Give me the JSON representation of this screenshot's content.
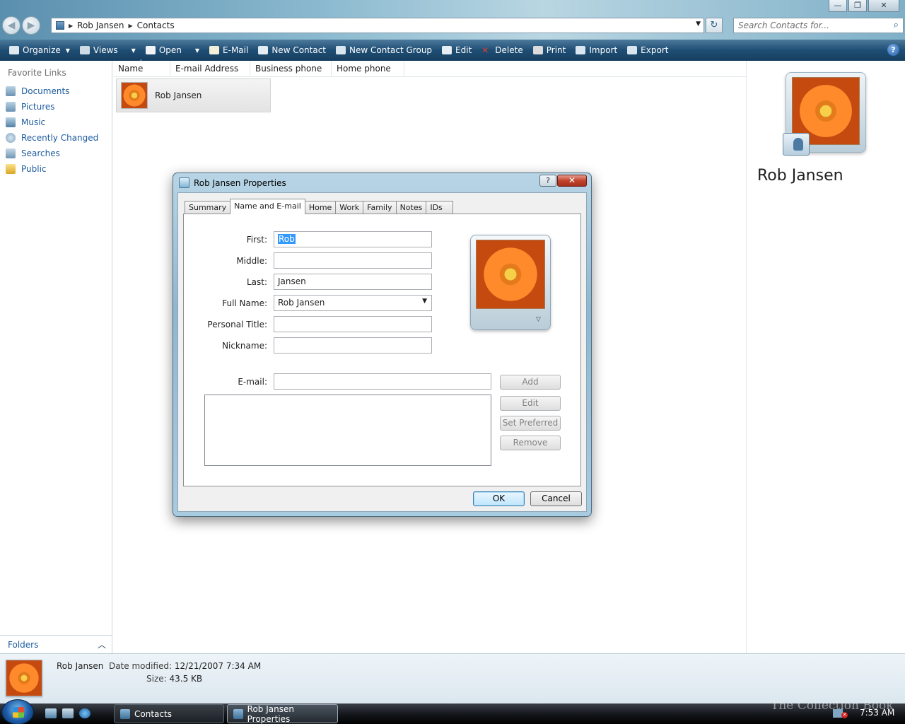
{
  "window": {
    "breadcrumb": [
      "Rob Jansen",
      "Contacts"
    ],
    "search_placeholder": "Search Contacts for...",
    "buttons": {
      "minimize": "—",
      "maximize": "❐",
      "close": "✕"
    }
  },
  "toolbar": {
    "items": [
      "Organize",
      "Views",
      "Open",
      "E-Mail",
      "New Contact",
      "New Contact Group",
      "Edit",
      "Delete",
      "Print",
      "Import",
      "Export"
    ]
  },
  "leftnav": {
    "heading": "Favorite Links",
    "items": [
      "Documents",
      "Pictures",
      "Music",
      "Recently Changed",
      "Searches",
      "Public"
    ],
    "folders": "Folders"
  },
  "list": {
    "columns": [
      "Name",
      "E-mail Address",
      "Business phone",
      "Home phone"
    ],
    "contacts": [
      {
        "name": "Rob Jansen"
      }
    ]
  },
  "preview": {
    "name": "Rob Jansen"
  },
  "details": {
    "name": "Rob Jansen",
    "modified_label": "Date modified:",
    "modified_value": "12/21/2007 7:34 AM",
    "size_label": "Size:",
    "size_value": "43.5 KB"
  },
  "dialog": {
    "title": "Rob Jansen Properties",
    "help": "?",
    "close": "✕",
    "tabs": [
      "Summary",
      "Name and E-mail",
      "Home",
      "Work",
      "Family",
      "Notes",
      "IDs"
    ],
    "active_tab": "Name and E-mail",
    "fields": {
      "first_label": "First:",
      "first_value": "Rob",
      "middle_label": "Middle:",
      "middle_value": "",
      "last_label": "Last:",
      "last_value": "Jansen",
      "fullname_label": "Full Name:",
      "fullname_value": "Rob Jansen",
      "title_label": "Personal Title:",
      "title_value": "",
      "nickname_label": "Nickname:",
      "nickname_value": "",
      "email_label": "E-mail:",
      "email_value": ""
    },
    "buttons": {
      "add": "Add",
      "edit": "Edit",
      "set_preferred": "Set Preferred",
      "remove": "Remove",
      "ok": "OK",
      "cancel": "Cancel"
    }
  },
  "taskbar": {
    "tasks": [
      "Contacts",
      "Rob Jansen Properties"
    ],
    "clock": "7:53 AM",
    "watermark": "The Collection Book"
  },
  "colors": {
    "accent": "#1f4e74",
    "link": "#1a5a9e",
    "selection": "#3399ff"
  }
}
